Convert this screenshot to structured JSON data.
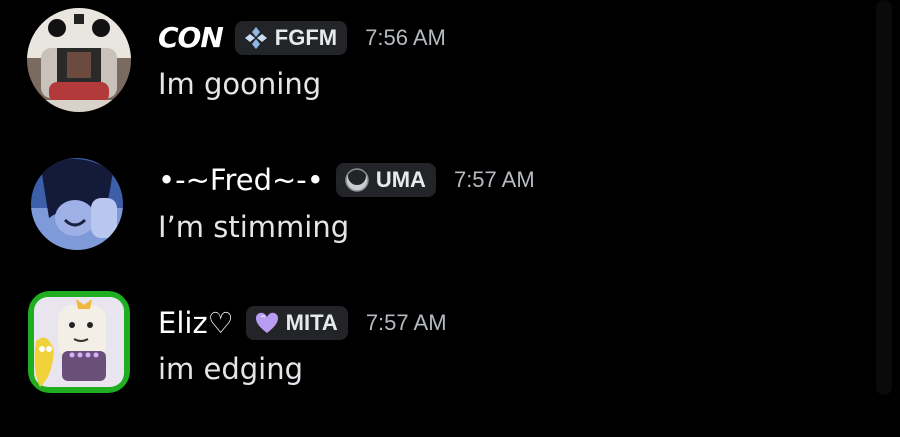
{
  "messages": [
    {
      "username": "CON",
      "tag": "FGFM",
      "tag_icon": "diamond-cluster-icon",
      "tag_icon_color": "#8fb8e8",
      "time": "7:56 AM",
      "text": "Im gooning",
      "avatar": "helmet-skull-avatar"
    },
    {
      "username": "•-~Fred~-•",
      "tag": "UMA",
      "tag_icon": "crescent-moon-icon",
      "tag_icon_color": "#c9ccd2",
      "time": "7:57 AM",
      "text": "I’m stimming",
      "avatar": "anime-character-avatar"
    },
    {
      "username": "Eliz♡",
      "tag": "MITA",
      "tag_icon": "purple-heart-icon",
      "tag_icon_color": "#b79cf2",
      "time": "7:57 AM",
      "text": "im edging",
      "avatar": "cartoon-banana-avatar"
    }
  ],
  "colors": {
    "background": "#000000",
    "username": "#ffffff",
    "timestamp": "#b5bac1",
    "tag_background": "#232428"
  }
}
